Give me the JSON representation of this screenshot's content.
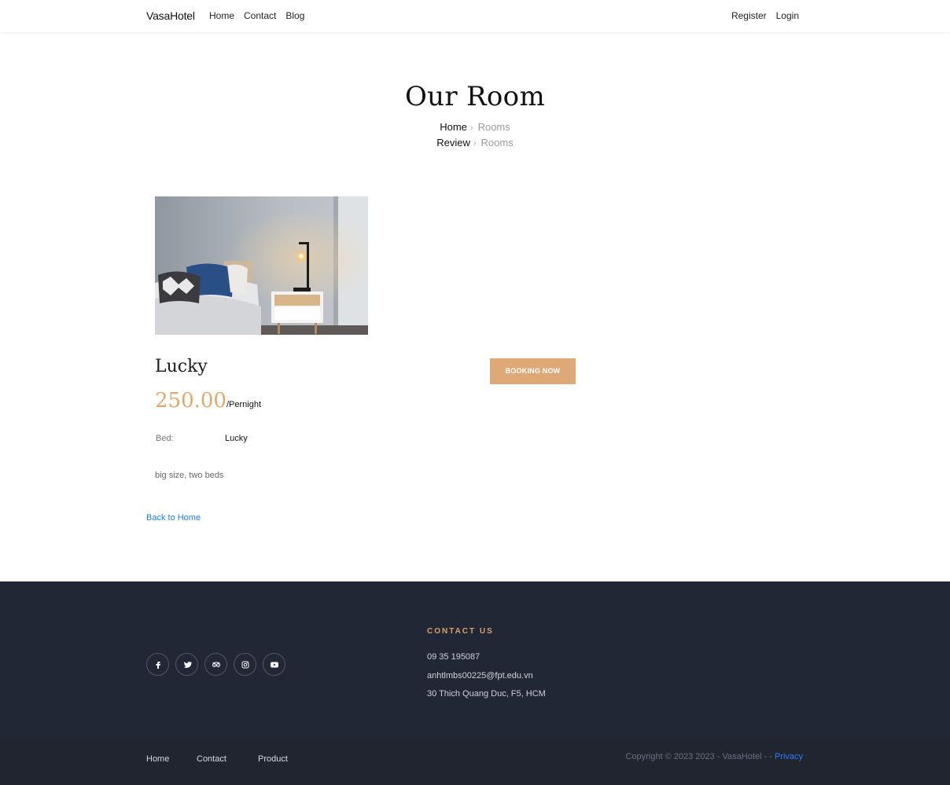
{
  "nav": {
    "brand": "VasaHotel",
    "links": [
      "Home",
      "Contact",
      "Blog"
    ],
    "right": [
      "Register",
      "Login"
    ]
  },
  "hero": {
    "title": "Our Room",
    "crumbs": [
      {
        "main": "Home",
        "sep": "›",
        "current": "Rooms"
      },
      {
        "main": "Review",
        "sep": "›",
        "current": "Rooms"
      }
    ]
  },
  "room": {
    "name": "Lucky",
    "price": "250.00",
    "price_unit": "/Pernight",
    "button": "BOOKING NOW",
    "bed_label": "Bed:",
    "bed_value": "Lucky",
    "description": "big size, two beds",
    "back_link": "Back to Home"
  },
  "footer": {
    "socials": [
      "facebook-icon",
      "twitter-icon",
      "tripadvisor-icon",
      "instagram-icon",
      "youtube-icon"
    ],
    "contact_heading": "CONTACT US",
    "phone": "09 35 195087",
    "email": "anhtlmbs00225@fpt.edu.vn",
    "address": "30 Thich Quang Duc, F5, HCM",
    "bottom_links": [
      "Home",
      "Contact",
      "Product"
    ],
    "copyright": "Copyright © 2023 2023 - VasaHotel - - ",
    "privacy": "Privacy"
  },
  "colors": {
    "accent": "#dfa977",
    "price": "#e0a86e",
    "footer_bg": "#222736",
    "link": "#1f7af0"
  }
}
